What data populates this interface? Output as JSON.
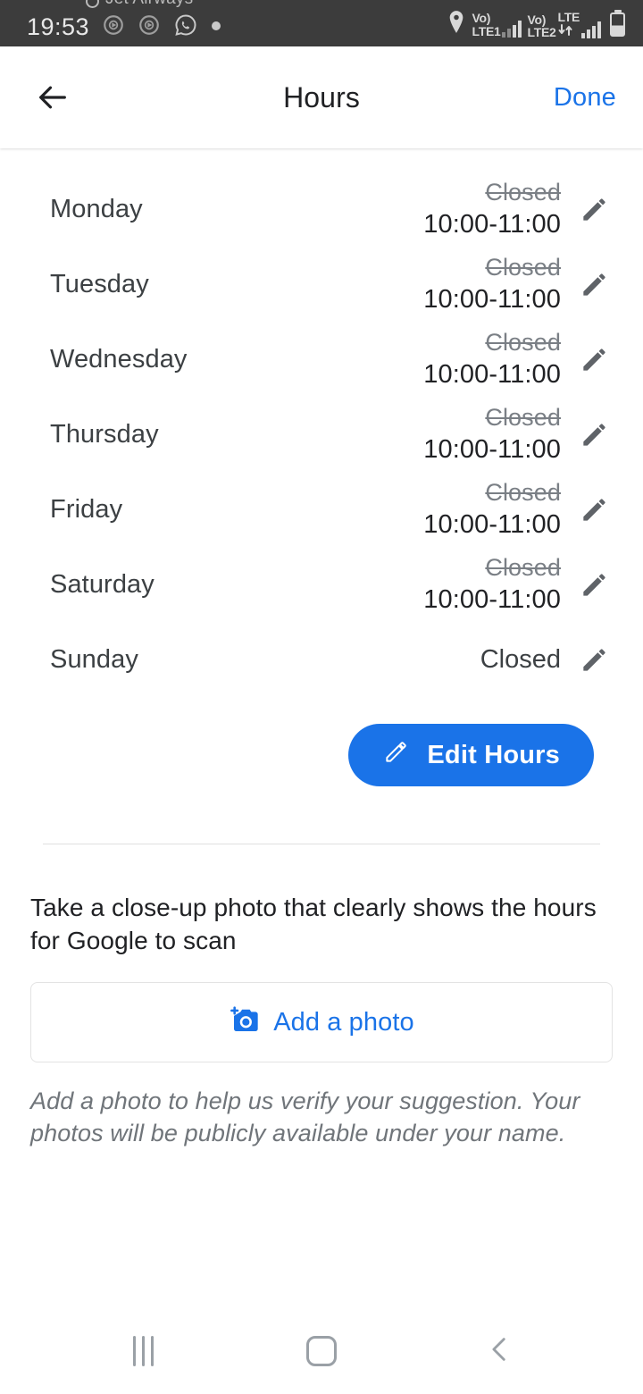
{
  "status_bar": {
    "ticker_text": "Jet Airways",
    "clock": "19:53",
    "icons": [
      "media-notification-icon",
      "media-notification-icon",
      "whatsapp-icon",
      "dot-icon"
    ],
    "sim1_volte": "Vo)",
    "sim1_label": "LTE1",
    "sim2_volte": "Vo)",
    "sim2_label": "LTE2",
    "network_type": "LTE",
    "location_icon": "location-pin-icon",
    "battery_icon": "battery-icon"
  },
  "header": {
    "back_icon": "back-arrow-icon",
    "title": "Hours",
    "done_label": "Done"
  },
  "hours": {
    "rows": [
      {
        "day": "Monday",
        "old": "Closed",
        "new": "10:00-11:00"
      },
      {
        "day": "Tuesday",
        "old": "Closed",
        "new": "10:00-11:00"
      },
      {
        "day": "Wednesday",
        "old": "Closed",
        "new": "10:00-11:00"
      },
      {
        "day": "Thursday",
        "old": "Closed",
        "new": "10:00-11:00"
      },
      {
        "day": "Friday",
        "old": "Closed",
        "new": "10:00-11:00"
      },
      {
        "day": "Saturday",
        "old": "Closed",
        "new": "10:00-11:00"
      },
      {
        "day": "Sunday",
        "single": "Closed"
      }
    ],
    "edit_button_label": "Edit Hours"
  },
  "photo": {
    "hint": "Take a close-up photo that clearly shows the hours for Google to scan",
    "add_label": "Add a photo",
    "note": "Add a photo to help us verify your suggestion. Your photos will be publicly available under your name."
  },
  "nav": {
    "recents_label": "recents-button",
    "home_label": "home-button",
    "back_label": "back-button"
  },
  "colors": {
    "accent_blue": "#1a73e8",
    "text_primary": "#202124",
    "text_secondary": "#70757a",
    "status_bar_bg": "#3c3c3c"
  }
}
